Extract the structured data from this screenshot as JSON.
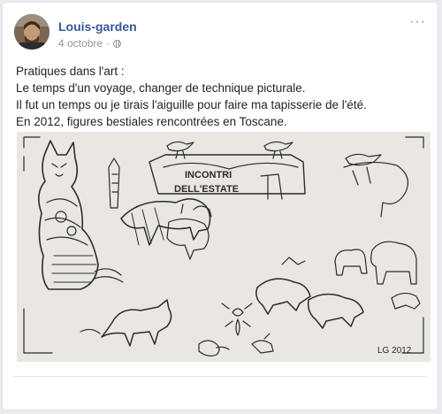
{
  "post": {
    "author": "Louis-garden",
    "date": "4 octobre",
    "separator": "·",
    "privacy_icon": "globe-icon",
    "more_icon": "more-options-icon",
    "more_label": "···",
    "lines": [
      "Pratiques dans l'art :",
      "Le temps d'un voyage, changer de technique picturale.",
      "Il fut un temps ou je tirais l'aiguille pour faire ma tapisserie de l'été.",
      "En 2012, figures bestiales rencontrées en Toscane."
    ]
  },
  "image": {
    "banner_line1": "INCONTRI",
    "banner_line2": "DELL'ESTATE",
    "signature": "LG 2012"
  },
  "colors": {
    "author_link": "#365899",
    "meta_gray": "#90949c",
    "text": "#1d2129"
  }
}
